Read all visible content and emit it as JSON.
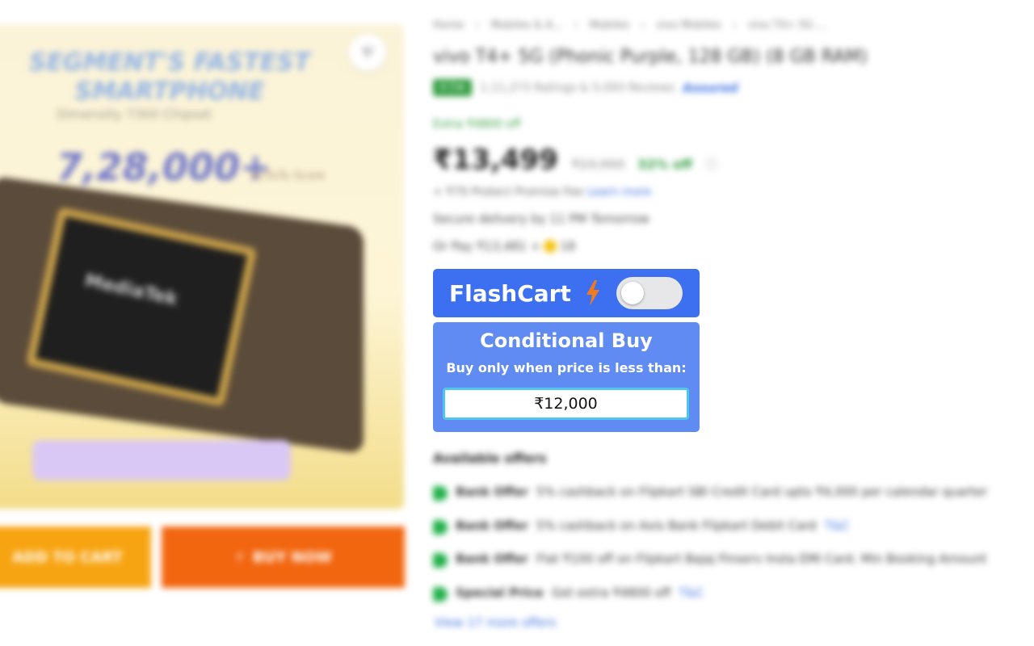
{
  "breadcrumb": [
    "Home",
    "Mobiles & A...",
    "Mobiles",
    "vivo Mobiles",
    "vivo T4+ 5G ..."
  ],
  "product": {
    "title": "vivo T4+ 5G (Phonic Purple, 128 GB) (8 GB RAM)",
    "rating": "4.5★",
    "rating_count": "1,11,273 Ratings & 5,093 Reviews",
    "assured_label": "Assured",
    "extra_off": "Extra ₹4800 off",
    "price": "₹13,499",
    "mrp": "₹19,999",
    "discount": "32% off",
    "protect_text": "+ ₹79 Protect Promise Fee",
    "learn_more": "Learn more",
    "delivery": "Secure delivery by 11 PM Tomorrow",
    "or_pay": "Or Pay ₹13,481 +",
    "coins": "18"
  },
  "image": {
    "headline": "SEGMENT'S FASTEST SMARTPHONE",
    "sub": "Dimensity 7300 Chipset",
    "big": "7,28,000+",
    "big_sub": "AnTuTu Score",
    "chip_label": "MediaTek",
    "fav_icon": "heart-icon"
  },
  "actions": {
    "add_to_cart": "ADD TO CART",
    "buy_now": "BUY NOW",
    "buy_icon": "⚡"
  },
  "flashcart": {
    "label": "FlashCart",
    "toggle_on": false,
    "bolt_color": "#f07b1d",
    "accent": "#3d6ff1"
  },
  "conditional": {
    "title": "Conditional Buy",
    "subtitle": "Buy only when price is less than:",
    "value": "₹12,000"
  },
  "offers": {
    "title": "Available offers",
    "items": [
      {
        "kind": "Bank Offer",
        "text": "5% cashback on Flipkart SBI Credit Card upto ₹4,000 per calendar quarter",
        "tc": ""
      },
      {
        "kind": "Bank Offer",
        "text": "5% cashback on Axis Bank Flipkart Debit Card",
        "tc": "T&C"
      },
      {
        "kind": "Bank Offer",
        "text": "Flat ₹100 off on Flipkart Bajaj Finserv Insta EMI Card. Min Booking Amount",
        "tc": ""
      },
      {
        "kind": "Special Price",
        "text": "Get extra ₹4800 off",
        "tc": "T&C"
      }
    ],
    "view_more": "View 17 more offers"
  }
}
